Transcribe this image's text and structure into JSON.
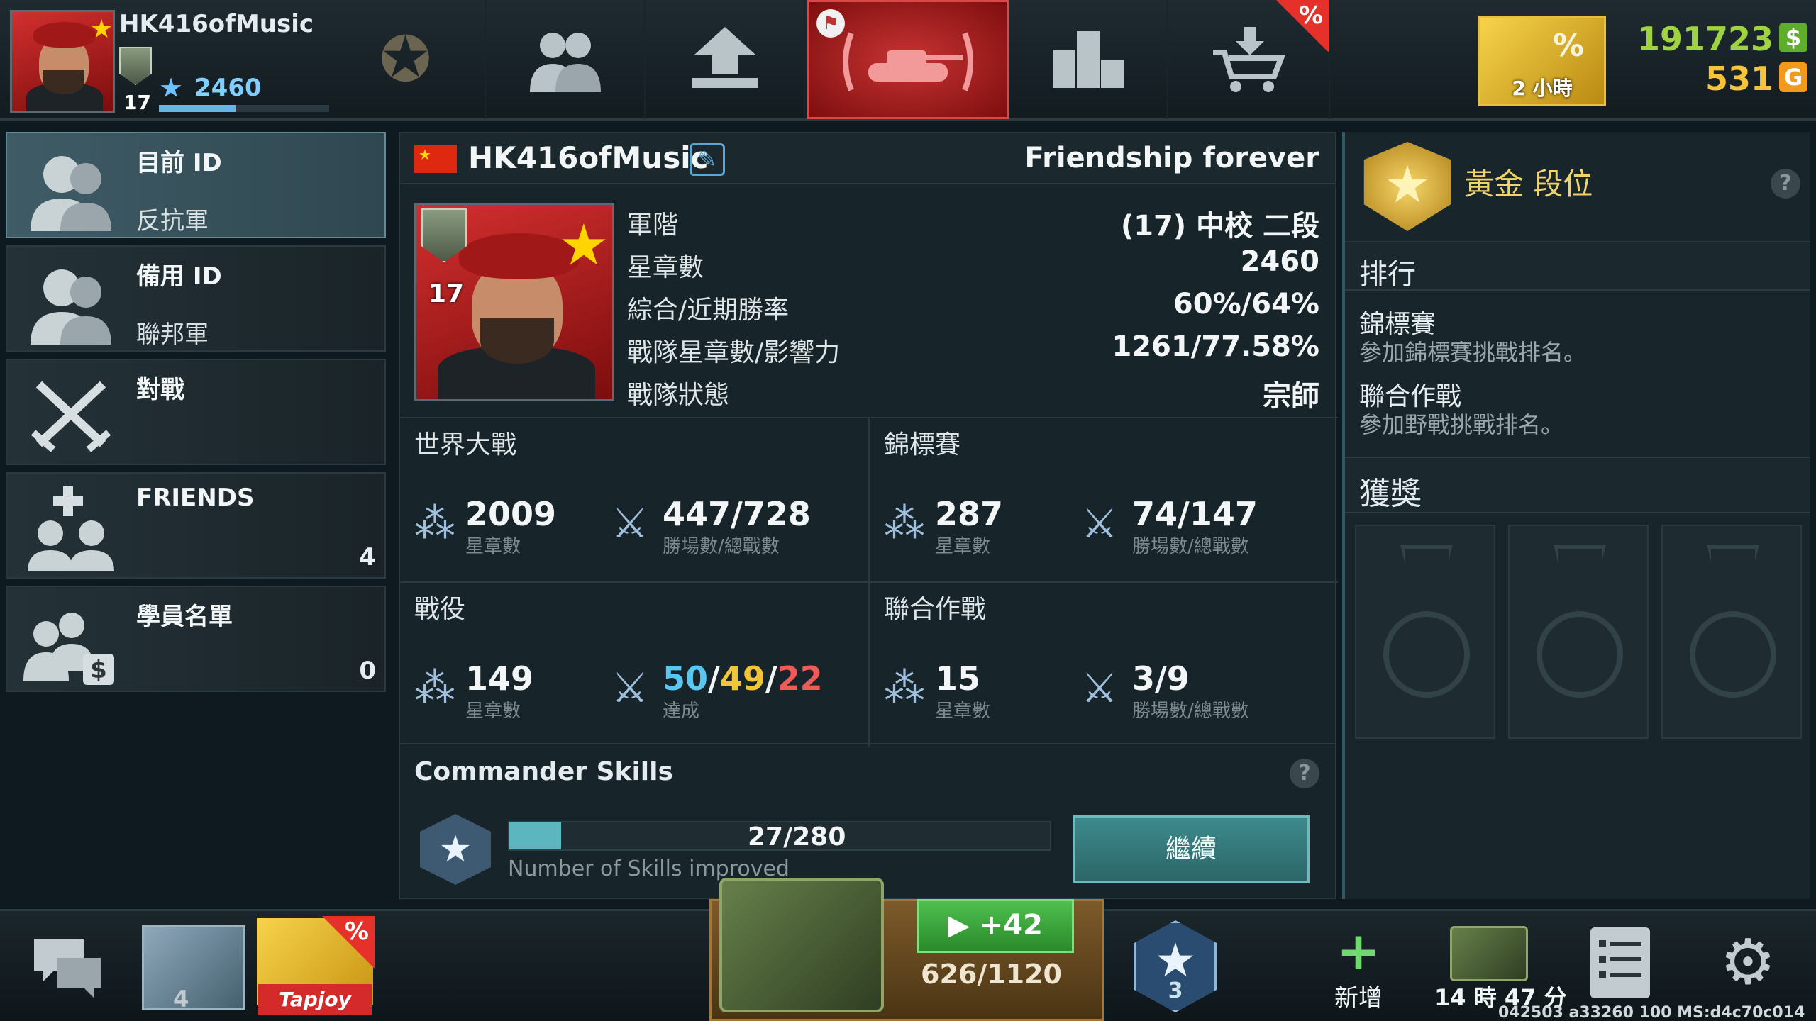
{
  "header": {
    "player_name": "HK416ofMusic",
    "rank_level": "17",
    "stars": "2460",
    "xp_progress": 0.45,
    "nav": [
      {
        "id": "medal",
        "icon": "medal-emblem-icon"
      },
      {
        "id": "community",
        "icon": "people-icon"
      },
      {
        "id": "upgrade",
        "icon": "upgrade-arrow-icon"
      },
      {
        "id": "garage",
        "icon": "tank-icon",
        "active": true
      },
      {
        "id": "ranking",
        "icon": "podium-icon"
      },
      {
        "id": "shop",
        "icon": "shopping-cart-icon",
        "sale_badge": "%"
      }
    ],
    "gold_offer": {
      "badge": "%",
      "timer": "2 小時"
    },
    "currency": {
      "dollars": "191723",
      "dollar_icon": "$",
      "gold": "531",
      "gold_icon": "G"
    }
  },
  "left_menu": [
    {
      "title": "目前 ID",
      "subtitle": "反抗軍",
      "count": "",
      "icon": "soldier-icon",
      "active": true
    },
    {
      "title": "備用 ID",
      "subtitle": "聯邦軍",
      "count": "",
      "icon": "soldier-icon"
    },
    {
      "title": "對戰",
      "subtitle": "",
      "count": "",
      "icon": "crossed-swords-icon"
    },
    {
      "title": "FRIENDS",
      "subtitle": "",
      "count": "4",
      "icon": "add-friends-icon"
    },
    {
      "title": "學員名單",
      "subtitle": "",
      "count": "0",
      "icon": "trainees-icon"
    }
  ],
  "profile": {
    "name": "HK416ofMusic",
    "motto": "Friendship forever",
    "rank_level": "17",
    "info": [
      {
        "label": "軍階",
        "value": "(17) 中校 二段"
      },
      {
        "label": "星章數",
        "value": "2460"
      },
      {
        "label": "綜合/近期勝率",
        "value": "60%/64%"
      },
      {
        "label": "戰隊星章數/影響力",
        "value": "1261/77.58%"
      },
      {
        "label": "戰隊狀態",
        "value": "宗師"
      }
    ],
    "stats": {
      "world_war": {
        "title": "世界大戰",
        "stars": "2009",
        "stars_caption": "星章數",
        "battles": "447/728",
        "battles_caption": "勝場數/總戰數"
      },
      "championship": {
        "title": "錦標賽",
        "stars": "287",
        "stars_caption": "星章數",
        "battles": "74/147",
        "battles_caption": "勝場數/總戰數"
      },
      "campaign": {
        "title": "戰役",
        "stars": "149",
        "stars_caption": "星章數",
        "win": "50",
        "draw": "49",
        "lose": "22",
        "sep": "/",
        "achieved_caption": "達成"
      },
      "joint_ops": {
        "title": "聯合作戰",
        "stars": "15",
        "stars_caption": "星章數",
        "battles": "3/9",
        "battles_caption": "勝場數/總戰數"
      }
    },
    "skills": {
      "title": "Commander Skills",
      "help": "?",
      "count": "27/280",
      "progress": 0.096,
      "caption": "Number of Skills improved",
      "button": "繼續"
    }
  },
  "right_panel": {
    "tier": "黃金 段位",
    "help": "?",
    "ranking_title": "排行",
    "ranking_entries": [
      {
        "title": "錦標賽",
        "desc": "參加錦標賽挑戰排名。"
      },
      {
        "title": "聯合作戰",
        "desc": "參加野戰挑戰排名。"
      }
    ],
    "awards_title": "獲獎",
    "award_slots": 3
  },
  "bottom_bar": {
    "crate_count": "4",
    "tapjoy_label": "Tapjoy",
    "tapjoy_sale": "%",
    "video_reward": "+42",
    "supply_progress": "626/1120",
    "rank_hex_num": "3",
    "add_label": "新增",
    "timer": "14 時 47 分",
    "build_info": "042503 a33260 100 MS:d4c70c014"
  }
}
